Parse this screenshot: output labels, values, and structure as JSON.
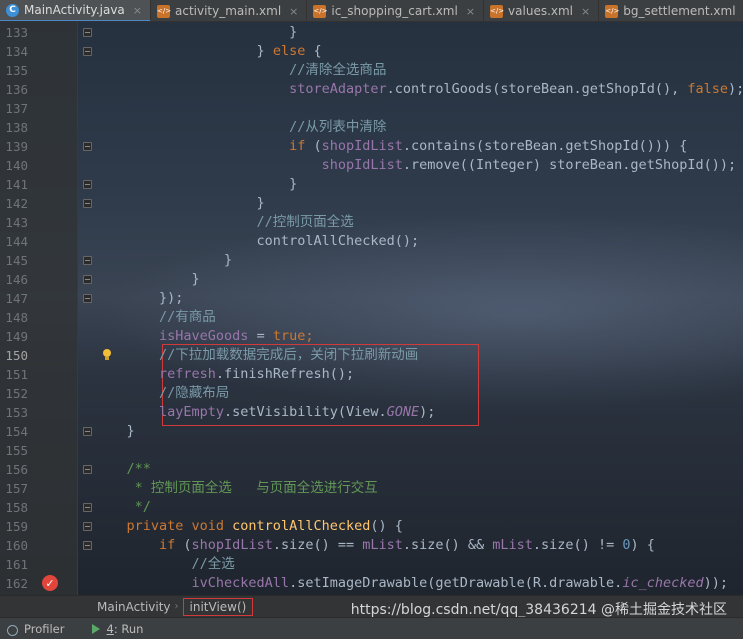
{
  "tabs": [
    {
      "label": "MainActivity.java",
      "icon": "java-class-icon",
      "active": true
    },
    {
      "label": "activity_main.xml",
      "icon": "xml-file-icon",
      "active": false
    },
    {
      "label": "ic_shopping_cart.xml",
      "icon": "xml-file-icon",
      "active": false
    },
    {
      "label": "values.xml",
      "icon": "xml-file-icon",
      "active": false
    },
    {
      "label": "bg_settlement.xml",
      "icon": "xml-file-icon",
      "active": false
    }
  ],
  "close_glyph": "×",
  "class_icon_letter": "C",
  "lines": [
    {
      "n": "133",
      "fold": true,
      "t": [
        [
          "",
          "                        }"
        ]
      ]
    },
    {
      "n": "134",
      "fold": true,
      "t": [
        [
          "",
          "                    } "
        ],
        [
          "kw",
          "else"
        ],
        [
          "",
          " {"
        ]
      ]
    },
    {
      "n": "135",
      "fold": false,
      "t": [
        [
          "cm",
          "                        //清除全选商品"
        ]
      ]
    },
    {
      "n": "136",
      "fold": false,
      "t": [
        [
          "fld",
          "                        storeAdapter"
        ],
        [
          "",
          ".controlGoods(storeBean.getShopId(), "
        ],
        [
          "kw",
          "false"
        ],
        [
          "",
          ");"
        ]
      ]
    },
    {
      "n": "137",
      "fold": false,
      "t": [
        [
          "",
          ""
        ]
      ]
    },
    {
      "n": "138",
      "fold": false,
      "t": [
        [
          "cm",
          "                        //从列表中清除"
        ]
      ]
    },
    {
      "n": "139",
      "fold": true,
      "t": [
        [
          "kw",
          "                        if"
        ],
        [
          "",
          " ("
        ],
        [
          "fld",
          "shopIdList"
        ],
        [
          "",
          ".contains(storeBean.getShopId())) {"
        ]
      ]
    },
    {
      "n": "140",
      "fold": false,
      "t": [
        [
          "fld",
          "                            shopIdList"
        ],
        [
          "",
          ".remove((Integer) storeBean.getShopId());"
        ]
      ]
    },
    {
      "n": "141",
      "fold": true,
      "t": [
        [
          "",
          "                        }"
        ]
      ]
    },
    {
      "n": "142",
      "fold": true,
      "t": [
        [
          "",
          "                    }"
        ]
      ]
    },
    {
      "n": "143",
      "fold": false,
      "t": [
        [
          "cm",
          "                    //控制页面全选"
        ]
      ]
    },
    {
      "n": "144",
      "fold": false,
      "t": [
        [
          "",
          "                    controlAllChecked();"
        ]
      ]
    },
    {
      "n": "145",
      "fold": true,
      "t": [
        [
          "",
          "                }"
        ]
      ]
    },
    {
      "n": "146",
      "fold": true,
      "t": [
        [
          "",
          "            }"
        ]
      ]
    },
    {
      "n": "147",
      "fold": true,
      "t": [
        [
          "",
          "        });"
        ]
      ]
    },
    {
      "n": "148",
      "fold": false,
      "t": [
        [
          "cm",
          "        //有商品"
        ]
      ]
    },
    {
      "n": "149",
      "fold": false,
      "t": [
        [
          "fld",
          "        isHaveGoods"
        ],
        [
          "",
          " = "
        ],
        [
          "kw",
          "true"
        ],
        [
          "kw",
          ";"
        ]
      ]
    },
    {
      "n": "150",
      "fold": false,
      "cur": true,
      "bulb": true,
      "t": [
        [
          "cm",
          "        //下拉加载数据完成后，关闭下拉刷新动画"
        ]
      ]
    },
    {
      "n": "151",
      "fold": false,
      "t": [
        [
          "fld",
          "        refresh"
        ],
        [
          "",
          ".finishRefresh();"
        ]
      ]
    },
    {
      "n": "152",
      "fold": false,
      "t": [
        [
          "cm",
          "        //隐藏布局"
        ]
      ]
    },
    {
      "n": "153",
      "fold": false,
      "t": [
        [
          "fld",
          "        layEmpty"
        ],
        [
          "",
          ".setVisibility(View."
        ],
        [
          "fld ital",
          "GONE"
        ],
        [
          "",
          ");"
        ]
      ]
    },
    {
      "n": "154",
      "fold": true,
      "t": [
        [
          "",
          "    }"
        ]
      ]
    },
    {
      "n": "155",
      "fold": false,
      "t": [
        [
          "",
          ""
        ]
      ]
    },
    {
      "n": "156",
      "fold": true,
      "t": [
        [
          "cmcn",
          "    /**"
        ]
      ]
    },
    {
      "n": "157",
      "fold": false,
      "t": [
        [
          "cmcn",
          "     * 控制页面全选   与页面全选进行交互"
        ]
      ]
    },
    {
      "n": "158",
      "fold": true,
      "t": [
        [
          "cmcn",
          "     */"
        ]
      ]
    },
    {
      "n": "159",
      "fold": true,
      "t": [
        [
          "kw",
          "    private void "
        ],
        [
          "meth",
          "controlAllChecked"
        ],
        [
          "",
          "() {"
        ]
      ]
    },
    {
      "n": "160",
      "fold": true,
      "t": [
        [
          "kw",
          "        if"
        ],
        [
          "",
          " ("
        ],
        [
          "fld",
          "shopIdList"
        ],
        [
          "",
          ".size() == "
        ],
        [
          "fld",
          "mList"
        ],
        [
          "",
          ".size() && "
        ],
        [
          "fld",
          "mList"
        ],
        [
          "",
          ".size() != "
        ],
        [
          "num",
          "0"
        ],
        [
          "",
          ") {"
        ]
      ]
    },
    {
      "n": "161",
      "fold": false,
      "t": [
        [
          "cm",
          "            //全选"
        ]
      ]
    },
    {
      "n": "162",
      "fold": false,
      "bp": true,
      "t": [
        [
          "fld",
          "            ivCheckedAll"
        ],
        [
          "",
          ".setImageDrawable(getDrawable(R.drawable."
        ],
        [
          "fld ital",
          "ic_checked"
        ],
        [
          "",
          "));"
        ]
      ]
    }
  ],
  "breadcrumb": {
    "class_name": "MainActivity",
    "separator": "›",
    "method": "initView()"
  },
  "watermark": "https://blog.csdn.net/qq_38436214",
  "watermark_extra": "@稀土掘金技术社区",
  "status": {
    "profiler": "Profiler",
    "run_num": "4",
    "run_label": ": Run"
  },
  "breakpoint_glyph": "✓"
}
